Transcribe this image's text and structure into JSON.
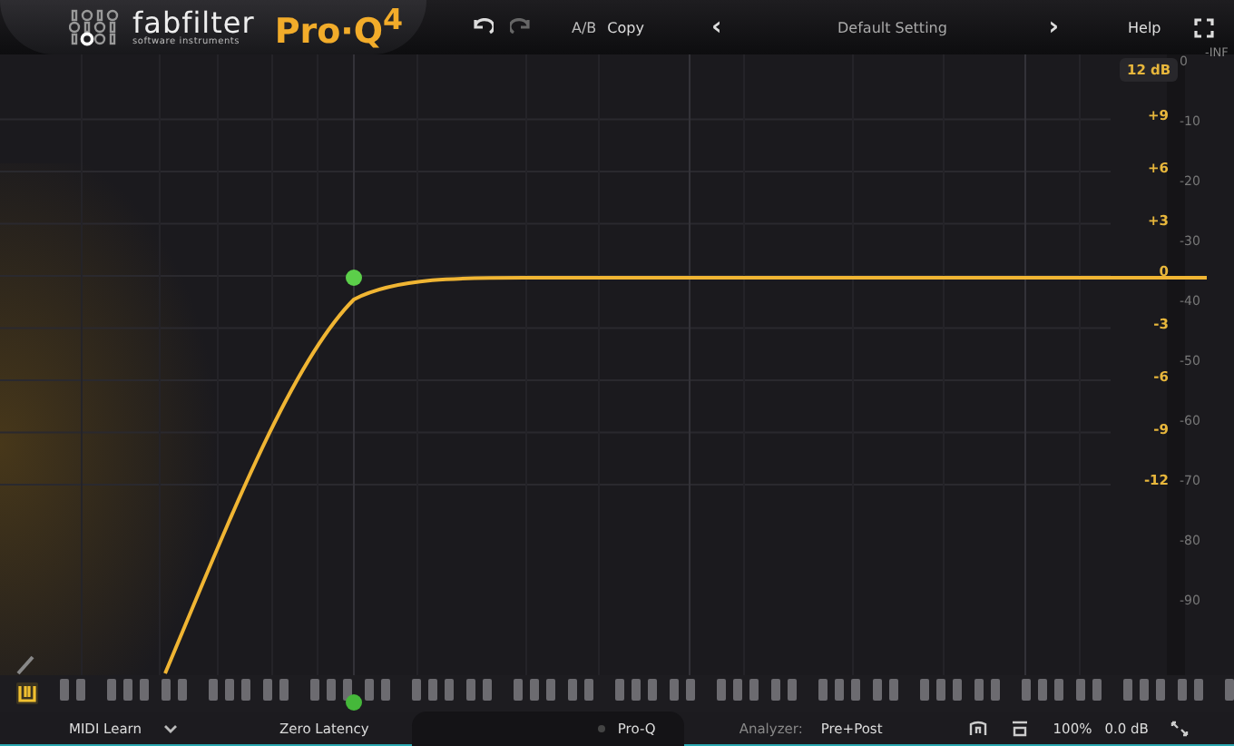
{
  "header": {
    "brand": "fabfilter",
    "tagline": "software instruments",
    "product": "Pro·Q$^{4}$",
    "ab": "A/B",
    "copy": "Copy",
    "prev": "‹",
    "preset": "Default Setting",
    "next": "›",
    "help": "Help"
  },
  "graph": {
    "range": "12 dB",
    "inf": "-INF",
    "gain_ticks": [
      "+9",
      "+6",
      "+3",
      "0",
      "-3",
      "-6",
      "-9",
      "-12"
    ],
    "db_ticks": [
      "0",
      "-10",
      "-20",
      "-30",
      "-40",
      "-50",
      "-60",
      "-70",
      "-80",
      "-90"
    ]
  },
  "bottom_bar": {
    "midi": "MIDI Learn",
    "latency": "Zero Latency",
    "instance": "Pro-Q",
    "analyzer_label": "Analyzer:",
    "analyzer_value": "Pre+Post",
    "zoom": "100%",
    "output": "0.0 dB"
  }
}
